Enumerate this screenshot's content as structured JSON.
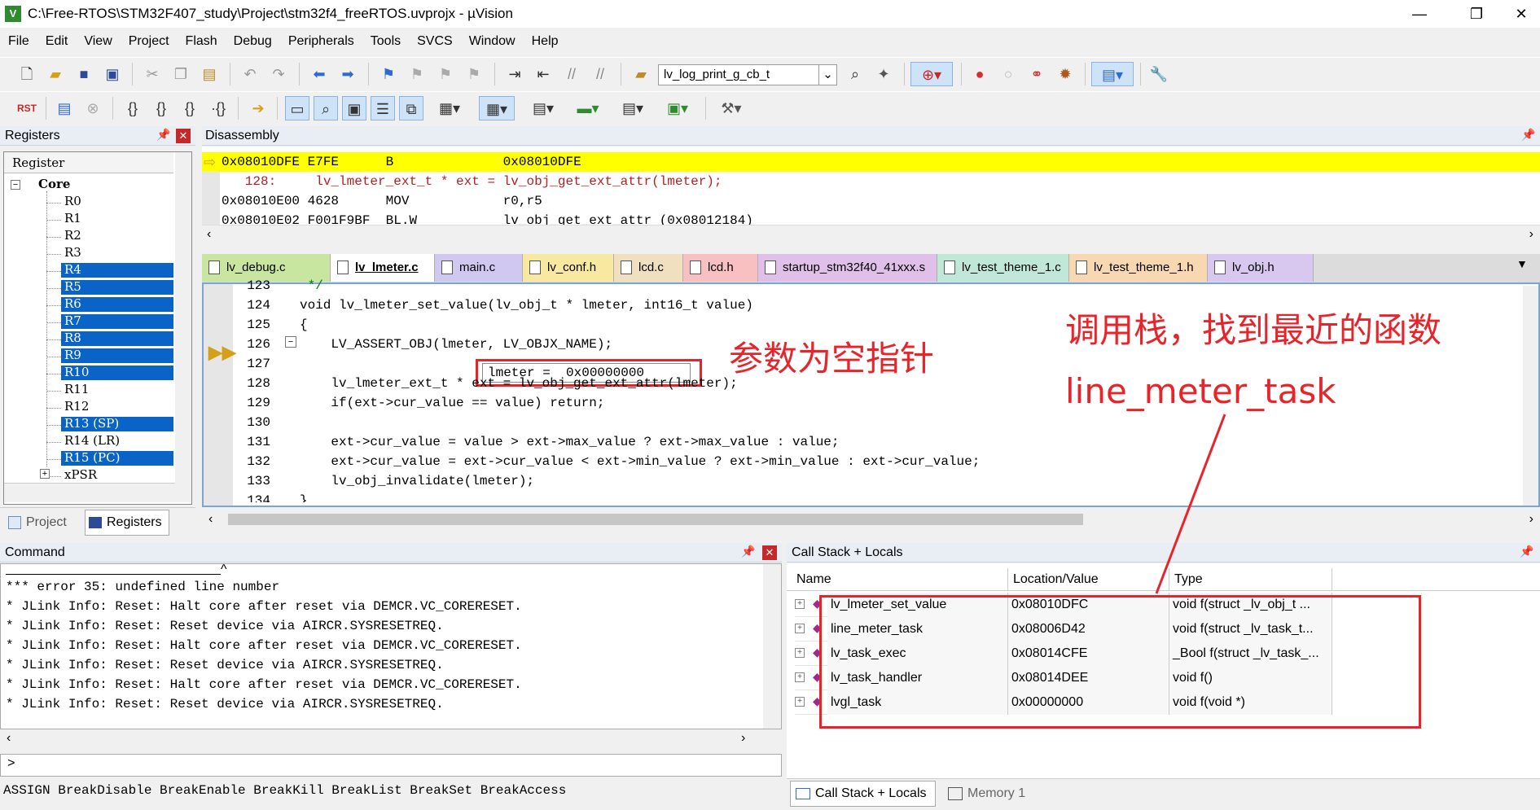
{
  "window": {
    "title": "C:\\Free-RTOS\\STM32F407_study\\Project\\stm32f4_freeRTOS.uvprojx - µVision",
    "icon_letter": "V",
    "controls": [
      "—",
      "❐",
      "✕"
    ]
  },
  "menu": [
    "File",
    "Edit",
    "View",
    "Project",
    "Flash",
    "Debug",
    "Peripherals",
    "Tools",
    "SVCS",
    "Window",
    "Help"
  ],
  "toolbar": {
    "find_combo": "lv_log_print_g_cb_t"
  },
  "registers": {
    "title": "Registers",
    "column": "Register",
    "group": "Core",
    "items": [
      "R0",
      "R1",
      "R2",
      "R3",
      "R4",
      "R5",
      "R6",
      "R7",
      "R8",
      "R9",
      "R10",
      "R11",
      "R12",
      "R13 (SP)",
      "R14 (LR)",
      "R15 (PC)",
      "xPSR"
    ],
    "selected": [
      false,
      false,
      false,
      false,
      true,
      true,
      true,
      true,
      true,
      true,
      true,
      false,
      false,
      true,
      false,
      true,
      false
    ]
  },
  "project_tabs": [
    "Project",
    "Registers"
  ],
  "disassembly": {
    "title": "Disassembly",
    "lines": [
      "0x08010DFE E7FE      B              0x08010DFE",
      "   128:     lv_lmeter_ext_t * ext = lv_obj_get_ext_attr(lmeter);",
      "0x08010E00 4628      MOV            r0,r5",
      "0x08010E02 F001F9BF  BL.W           lv_obj_get_ext_attr (0x08012184)"
    ]
  },
  "file_tabs": [
    "lv_debug.c",
    "lv_lmeter.c",
    "main.c",
    "lv_conf.h",
    "lcd.c",
    "lcd.h",
    "startup_stm32f40_41xxx.s",
    "lv_test_theme_1.c",
    "lv_test_theme_1.h",
    "lv_obj.h"
  ],
  "file_tab_colors": [
    "#c8e6a0",
    "#a8c8f0",
    "#d0c8f0",
    "#f8e8a0",
    "#f0e0c0",
    "#f8c0c0",
    "#e0c0e8",
    "#c0e8d8",
    "#f8d8b0",
    "#d8c8f0"
  ],
  "active_file_tab": 1,
  "editor": {
    "line_numbers": [
      "123",
      "124",
      "125",
      "126",
      "127",
      "128",
      "129",
      "130",
      "131",
      "132",
      "133",
      "134"
    ],
    "lines": [
      " */",
      "void lv_lmeter_set_value(lv_obj_t * lmeter, int16_t value)",
      "{",
      "    LV_ASSERT_OBJ(lmeter, LV_OBJX_NAME);",
      "",
      "    lv_lmeter_ext_t * ext = lv_obj_get_ext_attr(lmeter);",
      "    if(ext->cur_value == value) return;",
      "",
      "    ext->cur_value = value > ext->max_value ? ext->max_value : value;",
      "    ext->cur_value = ext->cur_value < ext->min_value ? ext->min_value : ext->cur_value;",
      "    lv_obj_invalidate(lmeter);",
      "}"
    ],
    "tooltip": "lmeter =  0x00000000"
  },
  "command": {
    "title": "Command",
    "lines": [
      "*** error 35: undefined line number",
      "* JLink Info: Reset: Halt core after reset via DEMCR.VC_CORERESET.",
      "* JLink Info: Reset: Reset device via AIRCR.SYSRESETREQ.",
      "* JLink Info: Reset: Halt core after reset via DEMCR.VC_CORERESET.",
      "* JLink Info: Reset: Reset device via AIRCR.SYSRESETREQ.",
      "* JLink Info: Reset: Halt core after reset via DEMCR.VC_CORERESET.",
      "* JLink Info: Reset: Reset device via AIRCR.SYSRESETREQ."
    ],
    "prompt": ">",
    "hint": "ASSIGN BreakDisable BreakEnable BreakKill BreakList BreakSet BreakAccess"
  },
  "callstack": {
    "title": "Call Stack + Locals",
    "columns": [
      "Name",
      "Location/Value",
      "Type"
    ],
    "rows": [
      {
        "name": "lv_lmeter_set_value",
        "loc": "0x08010DFC",
        "type": "void f(struct _lv_obj_t ..."
      },
      {
        "name": "line_meter_task",
        "loc": "0x08006D42",
        "type": "void f(struct _lv_task_t..."
      },
      {
        "name": "lv_task_exec",
        "loc": "0x08014CFE",
        "type": "_Bool f(struct _lv_task_..."
      },
      {
        "name": "lv_task_handler",
        "loc": "0x08014DEE",
        "type": "void f()"
      },
      {
        "name": "lvgl_task",
        "loc": "0x00000000",
        "type": "void f(void *)"
      }
    ],
    "bottom_tabs": [
      "Call Stack + Locals",
      "Memory 1"
    ]
  },
  "annotations": {
    "null_param": "参数为空指针",
    "callstack_note": "调用栈，找到最近的函数",
    "function_name": "line_meter_task",
    "color": "#e8242a"
  }
}
